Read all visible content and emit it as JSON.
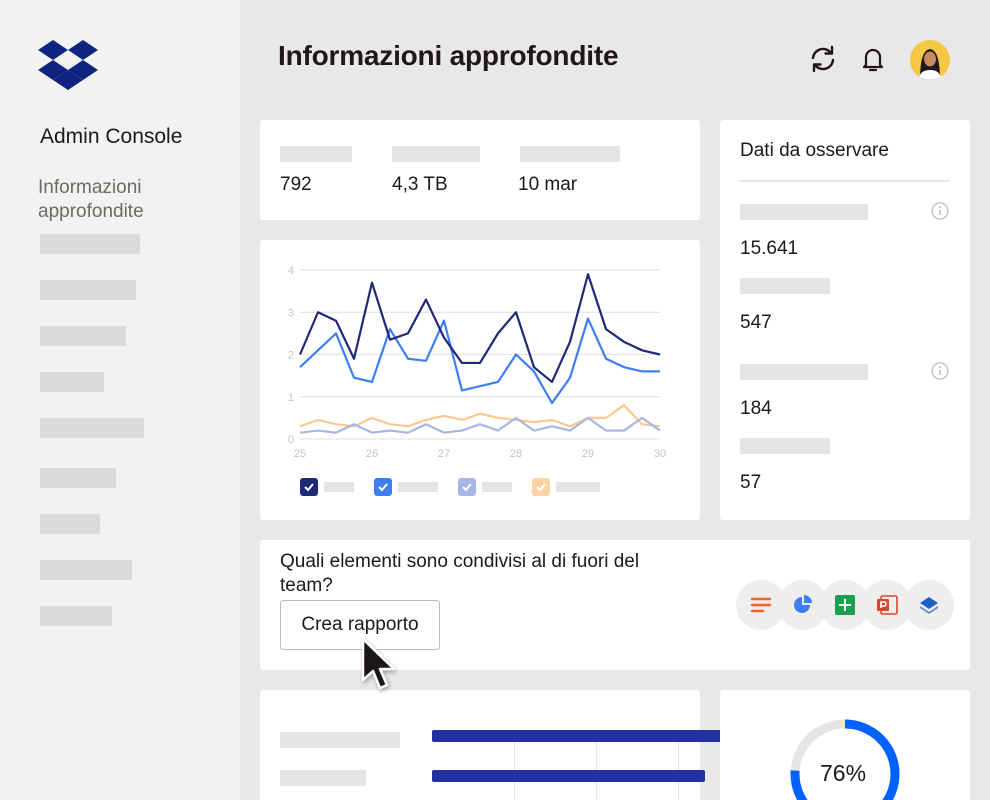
{
  "sidebar": {
    "app_name": "Admin Console",
    "active_item": "Informazioni approfondite",
    "logo": "dropbox-logo",
    "placeholder_count": 9
  },
  "header": {
    "title": "Informazioni approfondite",
    "icons": [
      "sync-icon",
      "bell-icon",
      "avatar"
    ]
  },
  "stats": {
    "values": [
      "792",
      "4,3 TB",
      "10 mar"
    ]
  },
  "watch": {
    "title": "Dati da osservare",
    "values": [
      "15.641",
      "547",
      "184",
      "57"
    ]
  },
  "chart_data": {
    "type": "line",
    "x": [
      25,
      25.25,
      25.5,
      25.75,
      26,
      26.25,
      26.5,
      26.75,
      27,
      27.25,
      27.5,
      27.75,
      28,
      28.25,
      28.5,
      28.75,
      29,
      29.25,
      29.5,
      29.75,
      30
    ],
    "x_ticks": [
      "25",
      "26",
      "27",
      "28",
      "29",
      "30"
    ],
    "y_ticks": [
      "0",
      "1",
      "2",
      "3",
      "4"
    ],
    "ylim": [
      0,
      4
    ],
    "series": [
      {
        "color": "#1e2a78",
        "values": [
          2.0,
          3.0,
          2.8,
          1.9,
          3.7,
          2.35,
          2.5,
          3.3,
          2.4,
          1.8,
          1.8,
          2.5,
          3.0,
          1.7,
          1.35,
          2.3,
          3.9,
          2.6,
          2.3,
          2.1,
          2.0
        ]
      },
      {
        "color": "#3d7ef2",
        "values": [
          1.7,
          2.1,
          2.5,
          1.45,
          1.35,
          2.6,
          1.9,
          1.85,
          2.8,
          1.15,
          1.25,
          1.35,
          2.0,
          1.6,
          0.85,
          1.45,
          2.85,
          1.9,
          1.7,
          1.6,
          1.6
        ]
      },
      {
        "color": "#a8b6e6",
        "values": [
          0.15,
          0.2,
          0.15,
          0.35,
          0.15,
          0.2,
          0.15,
          0.35,
          0.15,
          0.2,
          0.35,
          0.2,
          0.5,
          0.2,
          0.3,
          0.2,
          0.5,
          0.2,
          0.2,
          0.5,
          0.2
        ]
      },
      {
        "color": "#fcc88f",
        "values": [
          0.3,
          0.45,
          0.35,
          0.3,
          0.5,
          0.35,
          0.3,
          0.45,
          0.55,
          0.45,
          0.6,
          0.5,
          0.45,
          0.4,
          0.45,
          0.3,
          0.5,
          0.5,
          0.8,
          0.35,
          0.3
        ]
      }
    ]
  },
  "share": {
    "question": "Quali elementi sono condivisi al di fuori del team?",
    "button_label": "Crea rapporto",
    "file_types": [
      {
        "icon": "document-icon",
        "color": "#f0622d"
      },
      {
        "icon": "chart-file-icon",
        "color": "#3d7ef2"
      },
      {
        "icon": "spreadsheet-icon",
        "color": "#1e9e50"
      },
      {
        "icon": "presentation-icon",
        "color": "#d8462e"
      },
      {
        "icon": "dropbox-file-icon",
        "color": "#1e5fc8"
      }
    ]
  },
  "bar_card": {
    "bar_values": [
      1.0,
      0.86
    ]
  },
  "donut": {
    "label": "76%",
    "value": 0.76,
    "color": "#0061fe"
  }
}
